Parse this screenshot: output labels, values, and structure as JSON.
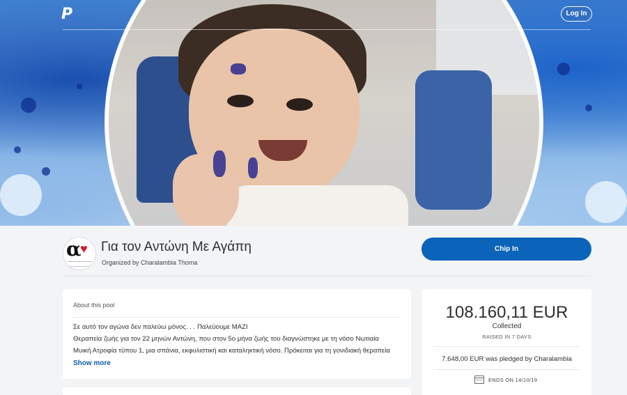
{
  "header": {
    "logo_icon": "paypal-logo-icon",
    "login_label": "Log In"
  },
  "pool": {
    "title": "Για τον Αντώνη Με Αγάπη",
    "organizer": "Organized by Charalambia Thoma",
    "avatar_icon": "organization-logo-icon",
    "chip_in_label": "Chip In"
  },
  "about": {
    "label": "About this pool",
    "lines": [
      "Σε αυτό τον αγώνα δεν παλεύω μόνος. . . Παλεύουμε ΜΑΖΙ",
      "Θεραπεία ζωής για τον 22 μηνών Αντώνη, που στον 5ο μήνα ζωής του διαγνώστηκε με τη νόσο Νωτιαία",
      "Μυική Ατροφία τύπου 1, μια σπάνια, εκφυλιστική και καταληκτική νόσο. Πρόκειται για τη γονιδιακή θεραπεία"
    ],
    "show_more_label": "Show more"
  },
  "stats": {
    "amount": "108.160,11 EUR",
    "collected_label": "Collected",
    "raised_label": "RAISED IN 7 DAYS",
    "pledge_text": "7.648,00 EUR was pledged by Charalambia",
    "ends_label": "ENDS ON 14/10/19",
    "calendar_icon": "calendar-icon"
  },
  "colors": {
    "primary_button": "#0b63ba",
    "link": "#0b5cab",
    "page_background": "#f2f4f6"
  }
}
